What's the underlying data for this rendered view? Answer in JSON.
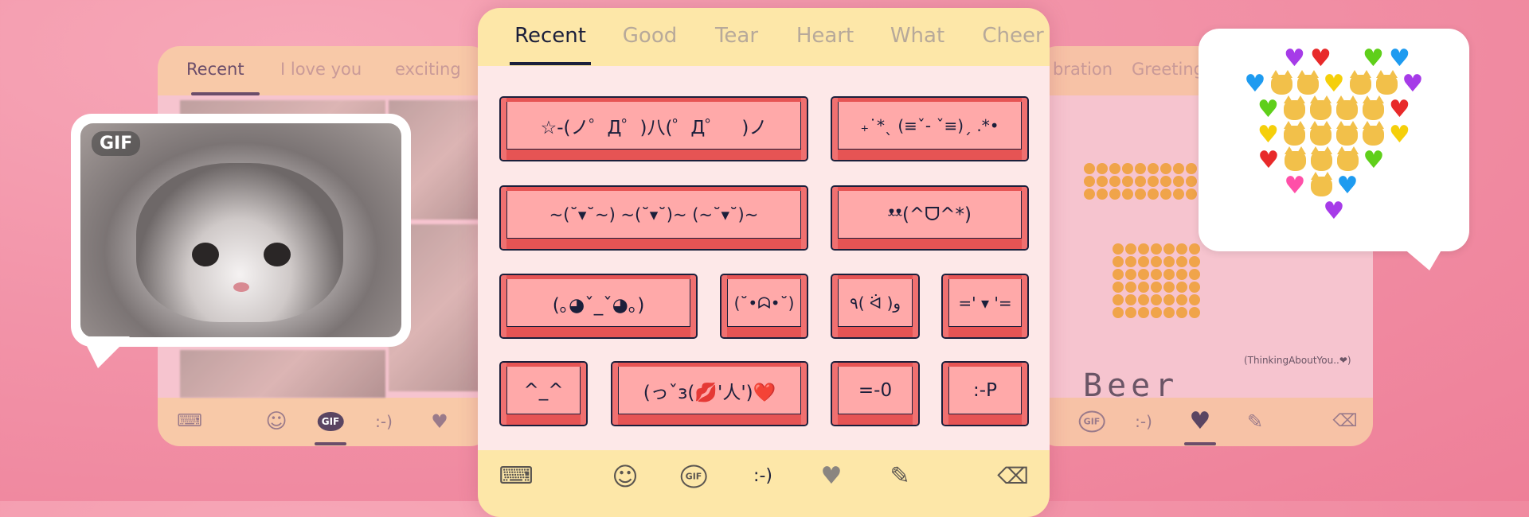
{
  "left_panel": {
    "tabs": [
      {
        "label": "Recent",
        "active": true
      },
      {
        "label": "I love you",
        "active": false
      },
      {
        "label": "exciting",
        "active": false
      }
    ],
    "bottom_bar": [
      {
        "icon": "keyboard-icon"
      },
      {
        "icon": "smile-icon"
      },
      {
        "icon": "gif-icon",
        "label": "GIF",
        "active": true
      },
      {
        "icon": "text-emoticon-icon",
        "label": ":-)"
      },
      {
        "icon": "dotted-heart-icon"
      }
    ]
  },
  "gif_bubble": {
    "badge": "GIF"
  },
  "center_panel": {
    "tabs": [
      {
        "label": "Recent",
        "active": true
      },
      {
        "label": "Good"
      },
      {
        "label": "Tear"
      },
      {
        "label": "Heart"
      },
      {
        "label": "What"
      },
      {
        "label": "Cheer"
      }
    ],
    "kaomoji": [
      "☆-(ノ゜Д゜)八(゜Д゜　)ノ",
      "₊˙*ˎ (≡ˇ- ˇ≡)ˏ .*•",
      "~(˘▾˘~) ~(˘▾˘)~ (~˘▾˘)~",
      "ᵜᵜ(^ᗜ^*)",
      "(｡◕ˇ_ˇ◕｡)",
      "(˘•ᗣ•˘)",
      "٩( ᐛ )و",
      "=' ▾ '=",
      "^_^",
      "(っˇз(💋'人')❤️",
      "=-0",
      ":-P"
    ],
    "bottom_bar": [
      {
        "icon": "keyboard-icon"
      },
      {
        "icon": "smile-icon"
      },
      {
        "icon": "gif-icon",
        "label": "GIF"
      },
      {
        "icon": "text-emoticon-icon",
        "label": ":-)",
        "active": true
      },
      {
        "icon": "dotted-heart-icon"
      },
      {
        "icon": "handwriting-pen-icon"
      },
      {
        "icon": "backspace-icon"
      }
    ]
  },
  "right_panel": {
    "tabs": [
      {
        "label": "bration"
      },
      {
        "label": "Greeting"
      }
    ],
    "art_caption": "(ThinkingAboutYou..❤)",
    "art_word": "Beer",
    "bottom_bar": [
      {
        "icon": "gif-icon",
        "label": "GIF"
      },
      {
        "icon": "text-emoticon-icon",
        "label": ":-)"
      },
      {
        "icon": "pixel-heart-icon",
        "active": true
      },
      {
        "icon": "handwriting-pen-icon"
      },
      {
        "icon": "backspace-icon"
      }
    ]
  },
  "heart_art": {
    "rows": [
      [
        "",
        "P",
        "R",
        "",
        "G",
        "B"
      ],
      [
        "B",
        "C",
        "C",
        "Y",
        "C",
        "C",
        "P"
      ],
      [
        "G",
        "C",
        "C",
        "C",
        "C",
        "R"
      ],
      [
        "Y",
        "C",
        "C",
        "C",
        "C",
        "Y"
      ],
      [
        "R",
        "C",
        "C",
        "C",
        "G"
      ],
      [
        "K",
        "C",
        "B"
      ],
      [
        "P"
      ]
    ],
    "colors": {
      "P": "#a63be8",
      "R": "#e82a2a",
      "G": "#5fcf1a",
      "B": "#1e9bf0",
      "Y": "#f5cf0a",
      "K": "#ff4fa8",
      "C": "#f2c04a"
    }
  },
  "colors": {
    "accent_dark": "#1b1f3b",
    "key_face": "#ffa9a9",
    "key_base": "#e65454",
    "center_bar": "#fde7a8",
    "center_body": "#fde8e8"
  }
}
